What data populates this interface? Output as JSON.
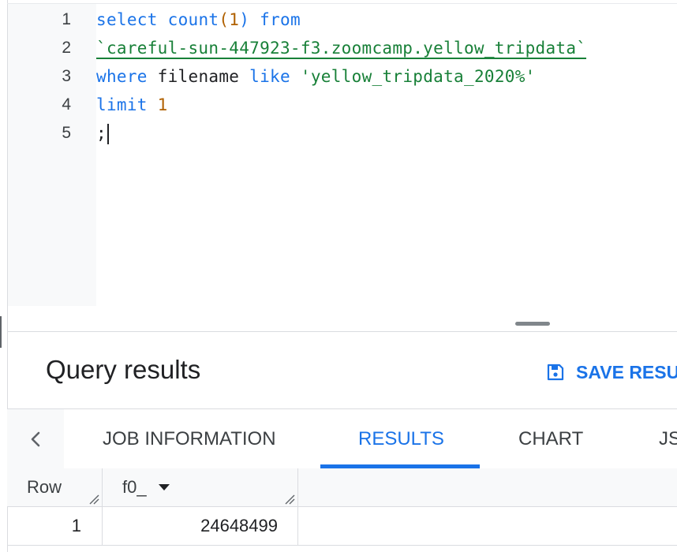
{
  "editor": {
    "line_numbers": [
      "1",
      "2",
      "3",
      "4",
      "5"
    ],
    "line1": {
      "kw_select": "select",
      "fn_count": "count",
      "paren_open": "(",
      "arg": "1",
      "paren_close": ")",
      "kw_from": "from"
    },
    "line2": {
      "table_ref": "`careful-sun-447923-f3.zoomcamp.yellow_tripdata`"
    },
    "line3": {
      "kw_where": "where",
      "ident": "filename",
      "kw_like": "like",
      "string": "'yellow_tripdata_2020%'"
    },
    "line4": {
      "kw_limit": "limit",
      "value": "1"
    },
    "line5": {
      "text": ";"
    }
  },
  "results": {
    "title": "Query results",
    "save_label": "SAVE RESU",
    "save_icon": "save-icon"
  },
  "tabs": [
    {
      "label": "JOB INFORMATION",
      "active": false
    },
    {
      "label": "RESULTS",
      "active": true
    },
    {
      "label": "CHART",
      "active": false
    },
    {
      "label": "JS",
      "active": false
    }
  ],
  "grid": {
    "headers": [
      "Row",
      "f0_"
    ],
    "rows": [
      {
        "row": "1",
        "f0_": "24648499"
      }
    ]
  },
  "colors": {
    "accent": "#1a73e8",
    "string": "#188038",
    "number": "#b06000"
  }
}
